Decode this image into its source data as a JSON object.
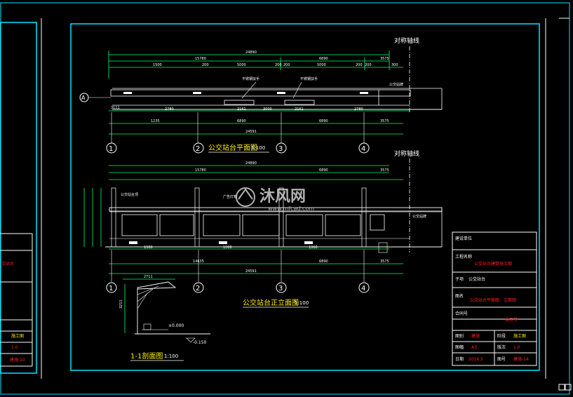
{
  "drawing": {
    "axis_line_label_top": "对称轴线",
    "axis_line_label_mid": "对称轴线",
    "plan_title": "公交站台平面图",
    "plan_scale": "1:100",
    "elev_title": "公交站台正立面图",
    "elev_scale": "1:100",
    "section_title": "1-1剖面图",
    "section_scale": "1:100",
    "watermark_text": "沐风网",
    "watermark_url": "www.mfcad.com",
    "axis_a": "A",
    "grid_labels": [
      "1",
      "2",
      "3",
      "4"
    ],
    "dims_top": [
      "24890",
      "15780",
      "6890",
      "3575"
    ],
    "dims_top2": [
      "1500",
      "200",
      "5000",
      "200",
      "200",
      "5000",
      "200",
      "200",
      "300"
    ],
    "dims_plan_bottom": [
      "3111",
      "2780",
      "2161",
      "3000",
      "2161",
      "2780"
    ],
    "dims_plan_bottom2": [
      "1235",
      "6890",
      "6890",
      "3575"
    ],
    "dims_plan_total": "24591",
    "dims_elev_top": [
      "24890",
      "15780",
      "6890",
      "3575"
    ],
    "dims_elev_bottom": [
      "1900",
      "1900",
      "1900"
    ],
    "dims_elev_bottom2": [
      "14635",
      "6890",
      "3575"
    ],
    "dims_elev_total": "24591",
    "note_plan_1": "不锈钢扶手",
    "note_plan_2": "不锈钢扶手",
    "note_plan_3": "公交站牌",
    "note_elev_1": "公交站台顶",
    "note_elev_2": "广告灯箱",
    "note_elev_3": "公交站牌",
    "section_dim_1": "2711",
    "section_dim_2": "3211",
    "section_level_1": "±0.000",
    "section_level_2": "-0.150"
  },
  "title_block": {
    "rows": [
      {
        "key": "建设单位",
        "value": ""
      },
      {
        "key": "工程名称",
        "value": "公交站台建筑施工图"
      },
      {
        "key": "子项",
        "value": "公交站台"
      },
      {
        "key": "图名",
        "value": "公交站台平面图、立面图"
      },
      {
        "key": "合同号",
        "value": "合同号"
      },
      {
        "key": "图别",
        "value": "建施"
      },
      {
        "key": "阶段",
        "value": "施工图"
      },
      {
        "key": "图幅",
        "value": "A3"
      },
      {
        "key": "版次",
        "value": "1.0"
      },
      {
        "key": "日期",
        "value": "2016.5"
      },
      {
        "key": "图号",
        "value": "建施-14"
      }
    ]
  },
  "left_sheet": {
    "texts": [
      "交站台",
      "施工图",
      "1.0",
      "建施-10"
    ]
  },
  "colors": {
    "background": "#000000",
    "frame": "#00e5ff",
    "line": "#ffffff",
    "dim": "#00ff66",
    "text_red": "#ff2020",
    "text_yellow": "#ffee00",
    "grid_circle": "#ffffff"
  }
}
